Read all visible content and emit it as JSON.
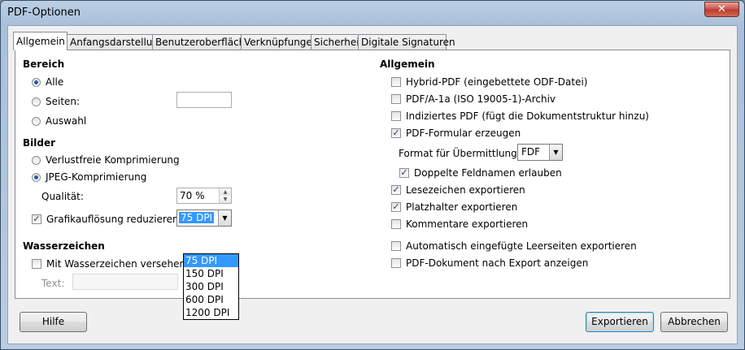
{
  "window": {
    "title": "PDF-Optionen",
    "close_label": "✕"
  },
  "tabs": [
    {
      "label": "Allgemein"
    },
    {
      "label": "Anfangsdarstellung"
    },
    {
      "label": "Benutzeroberfläche"
    },
    {
      "label": "Verknüpfungen"
    },
    {
      "label": "Sicherheit"
    },
    {
      "label": "Digitale Signaturen"
    }
  ],
  "left": {
    "bereich": {
      "heading": "Bereich",
      "alle": "Alle",
      "seiten": "Seiten:",
      "seiten_value": "",
      "auswahl": "Auswahl"
    },
    "bilder": {
      "heading": "Bilder",
      "verlustfrei": "Verlustfreie Komprimierung",
      "jpeg": "JPEG-Komprimierung",
      "qualitaet_label": "Qualität:",
      "qualitaet_value": "70 %",
      "grafik_label": "Grafikauflösung reduzieren",
      "dpi_value": "75 DPI",
      "dpi_options": [
        "75 DPI",
        "150 DPI",
        "300 DPI",
        "600 DPI",
        "1200 DPI"
      ]
    },
    "wasserzeichen": {
      "heading": "Wasserzeichen",
      "mit_label": "Mit Wasserzeichen versehen",
      "text_label": "Text:",
      "text_value": ""
    }
  },
  "right": {
    "heading": "Allgemein",
    "hybrid": "Hybrid-PDF (eingebettete ODF-Datei)",
    "pdfa": "PDF/A-1a (ISO 19005-1)-Archiv",
    "indiziert": "Indiziertes PDF (fügt die Dokumentstruktur hinzu)",
    "formular": "PDF-Formular erzeugen",
    "format_label": "Format für Übermittlung:",
    "format_value": "FDF",
    "doppelte": "Doppelte Feldnamen erlauben",
    "lesezeichen": "Lesezeichen exportieren",
    "platzhalter": "Platzhalter exportieren",
    "kommentare": "Kommentare exportieren",
    "leerseiten": "Automatisch eingefügte Leerseiten exportieren",
    "anzeigen": "PDF-Dokument nach Export anzeigen"
  },
  "buttons": {
    "hilfe": "Hilfe",
    "exportieren": "Exportieren",
    "abbrechen": "Abbrechen"
  },
  "icons": {
    "check": "✓",
    "arrow_down": "▼",
    "arrow_up": "▲"
  }
}
